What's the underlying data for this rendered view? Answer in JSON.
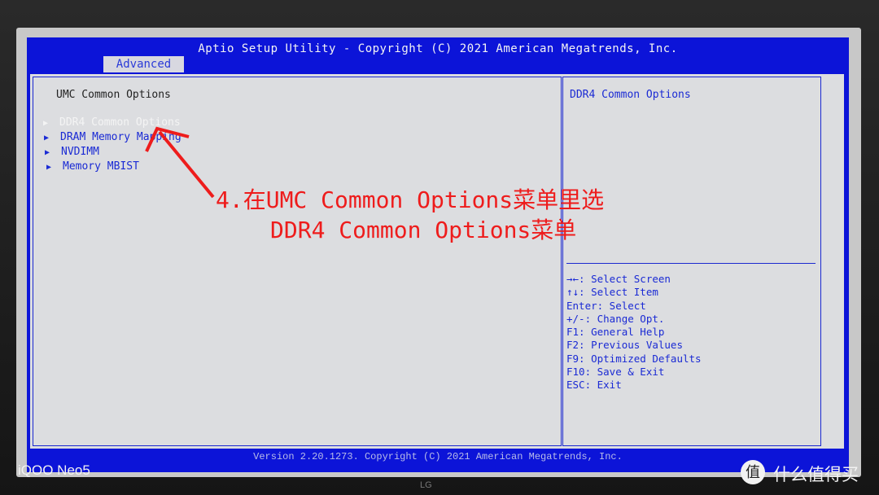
{
  "bios": {
    "title": "Aptio Setup Utility - Copyright (C) 2021 American Megatrends, Inc.",
    "active_tab": "Advanced",
    "page_title": "UMC Common Options",
    "menu_items": [
      {
        "label": "DDR4 Common Options",
        "selected": true
      },
      {
        "label": "DRAM Memory Mapping",
        "selected": false
      },
      {
        "label": "NVDIMM",
        "selected": false
      },
      {
        "label": "Memory MBIST",
        "selected": false
      }
    ],
    "help_text": "DDR4 Common Options",
    "key_help": [
      "→←: Select Screen",
      "↑↓: Select Item",
      "Enter: Select",
      "+/-: Change Opt.",
      "F1: General Help",
      "F2: Previous Values",
      "F9: Optimized Defaults",
      "F10: Save & Exit",
      "ESC: Exit"
    ],
    "footer": "Version 2.20.1273. Copyright (C) 2021 American Megatrends, Inc."
  },
  "annotation": {
    "line1": "4.在UMC Common Options菜单里选",
    "line2": "DDR4 Common Options菜单",
    "color": "#ee1c1c"
  },
  "watermarks": {
    "camera": "iQOO Neo5",
    "site": "什么值得买",
    "site_logo_char": "值",
    "monitor_brand": "LG"
  },
  "colors": {
    "bios_blue": "#0c14d8",
    "panel_grey": "#dcdde0",
    "text_blue": "#1a2ad4"
  }
}
